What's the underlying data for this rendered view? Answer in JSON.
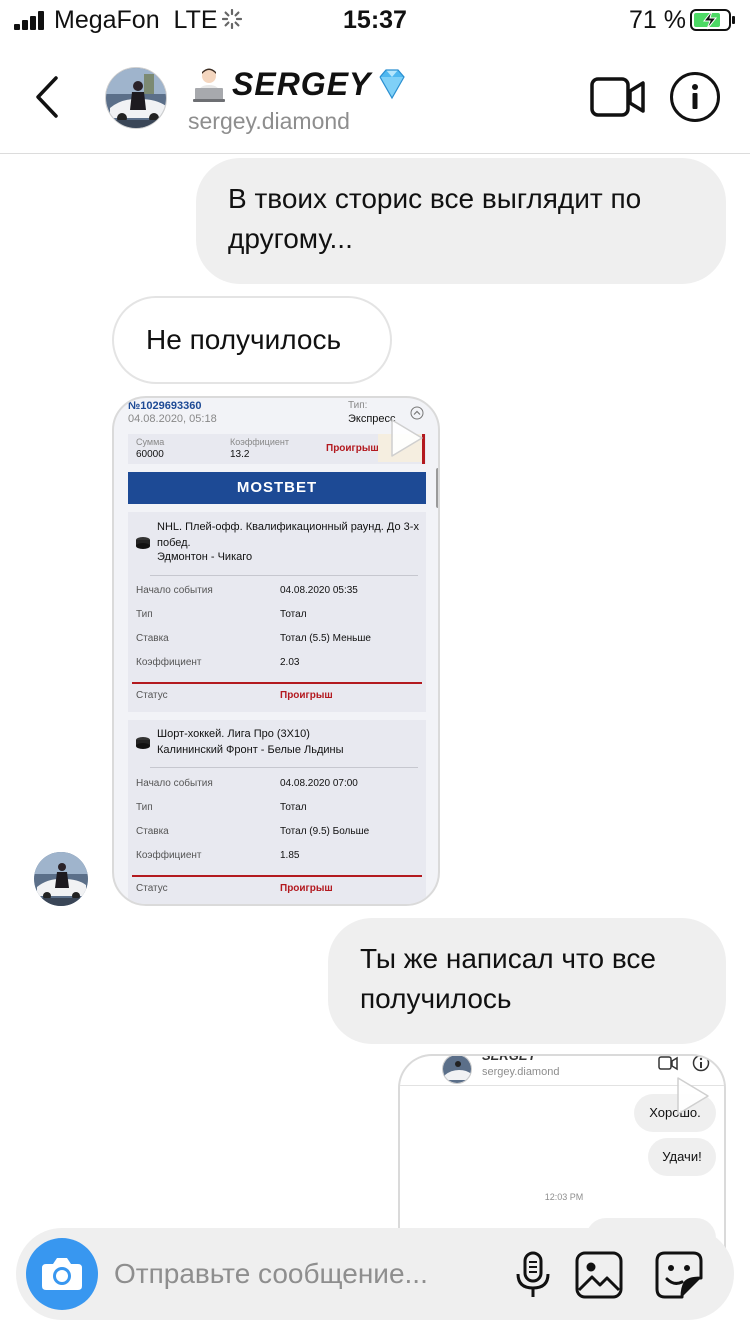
{
  "status_bar": {
    "carrier": "MegaFon",
    "network": "LTE",
    "time": "15:37",
    "battery_percent": "71 %"
  },
  "header": {
    "title": "SERGEY",
    "subtitle": "sergey.diamond"
  },
  "messages": [
    {
      "direction": "outgoing",
      "text": "В твоих сторис все выглядит по другому..."
    },
    {
      "direction": "incoming",
      "text": "Не получилось"
    },
    {
      "direction": "incoming",
      "type": "image",
      "content": "bet_screenshot"
    },
    {
      "direction": "outgoing",
      "text": "Ты же написал что все получилось"
    },
    {
      "direction": "outgoing",
      "type": "image",
      "content": "chat_screenshot"
    }
  ],
  "bet_screenshot": {
    "ticket_number": "№1029693360",
    "ticket_date": "04.08.2020, 05:18",
    "type_label": "Тип:",
    "type_value": "Экспресс",
    "sum_label": "Сумма",
    "sum_value": "60000",
    "coef_label": "Коэффициент",
    "coef_value": "13.2",
    "result": "Проигрыш",
    "brand": "MOSTBET",
    "events": [
      {
        "tournament": "NHL. Плей-офф. Квалификационный раунд. До 3-х побед.",
        "teams": "Эдмонтон - Чикаго",
        "start_label": "Начало события",
        "start_value": "04.08.2020 05:35",
        "type_label": "Тип",
        "type_value": "Тотал",
        "bet_label": "Ставка",
        "bet_value": "Тотал (5.5) Меньше",
        "coef_label": "Коэффициент",
        "coef_value": "2.03",
        "status_label": "Статус",
        "status_value": "Проигрыш"
      },
      {
        "tournament": "Шорт-хоккей. Лига Про (3X10)",
        "teams": "Калининский Фронт - Белые Льдины",
        "start_label": "Начало события",
        "start_value": "04.08.2020 07:00",
        "type_label": "Тип",
        "type_value": "Тотал",
        "bet_label": "Ставка",
        "bet_value": "Тотал (9.5) Больше",
        "coef_label": "Коэффициент",
        "coef_value": "1.85",
        "status_label": "Статус",
        "status_value": "Проигрыш"
      }
    ]
  },
  "chat_screenshot": {
    "title": "SERGEY",
    "subtitle": "sergey.diamond",
    "messages": [
      "Хорошо.",
      "Удачи!"
    ],
    "timestamp": "12:03 PM"
  },
  "composer": {
    "placeholder": "Отправьте сообщение..."
  },
  "colors": {
    "accent": "#3897f0",
    "loss": "#b3191f",
    "mostbet_blue": "#1d4a95",
    "charging": "#4cd964"
  },
  "icons": [
    "back-icon",
    "video-call-icon",
    "info-icon",
    "camera-icon",
    "microphone-icon",
    "gallery-icon",
    "sticker-icon",
    "play-icon",
    "puck-icon"
  ]
}
